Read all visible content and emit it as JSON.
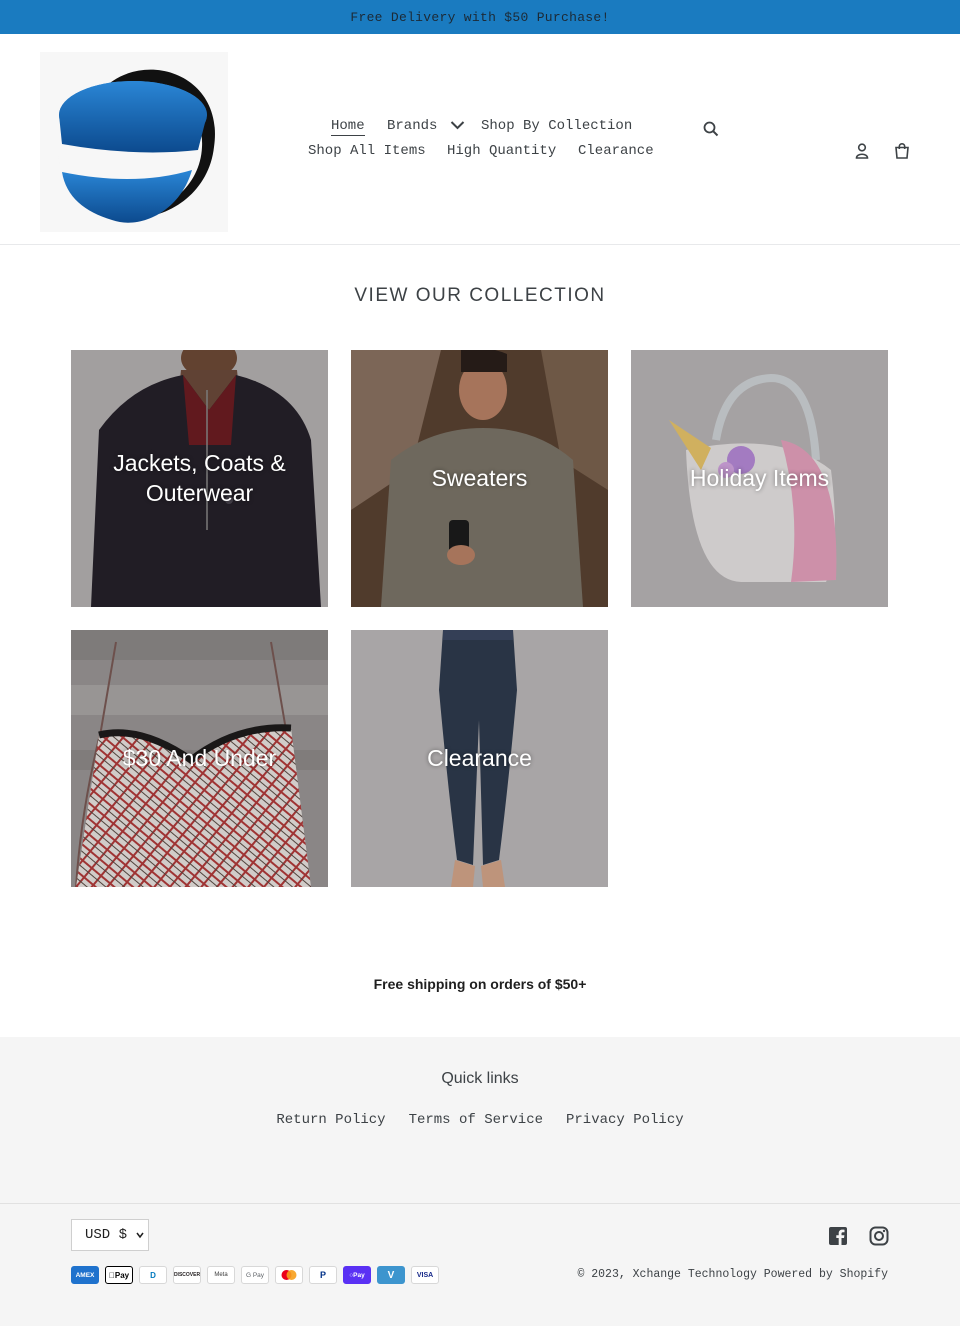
{
  "announcement": "Free Delivery with $50 Purchase!",
  "header": {
    "logo_alt": "Xchange Technology",
    "nav_row1": [
      {
        "label": "Home",
        "active": true
      },
      {
        "label": "Brands",
        "has_dropdown": true
      },
      {
        "label": "Shop By Collection"
      }
    ],
    "nav_row2": [
      {
        "label": "Shop All Items"
      },
      {
        "label": "High Quantity"
      },
      {
        "label": "Clearance"
      }
    ],
    "icons": [
      "search-icon",
      "account-icon",
      "cart-icon"
    ]
  },
  "collections": {
    "title": "VIEW OUR COLLECTION",
    "items": [
      {
        "label": "Jackets, Coats & Outerwear"
      },
      {
        "label": "Sweaters"
      },
      {
        "label": "Holiday Items"
      },
      {
        "label": "$30 And Under"
      },
      {
        "label": "Clearance"
      }
    ]
  },
  "promo": "Free shipping on orders of $50+",
  "footer": {
    "quick_links_title": "Quick links",
    "links": [
      "Return Policy",
      "Terms of Service",
      "Privacy Policy"
    ],
    "currency": "USD $",
    "social": [
      "facebook-icon",
      "instagram-icon"
    ],
    "payments": [
      "AMEX",
      "Pay",
      "D",
      "DISCOVER",
      "Meta",
      "G Pay",
      "MC",
      "P",
      "Pay",
      "V",
      "VISA"
    ],
    "copyright": "© 2023, Xchange Technology Powered by Shopify"
  },
  "colors": {
    "announcement_bg": "#1a7bc0",
    "footer_bg": "#f5f5f5",
    "text": "#3d4246"
  }
}
